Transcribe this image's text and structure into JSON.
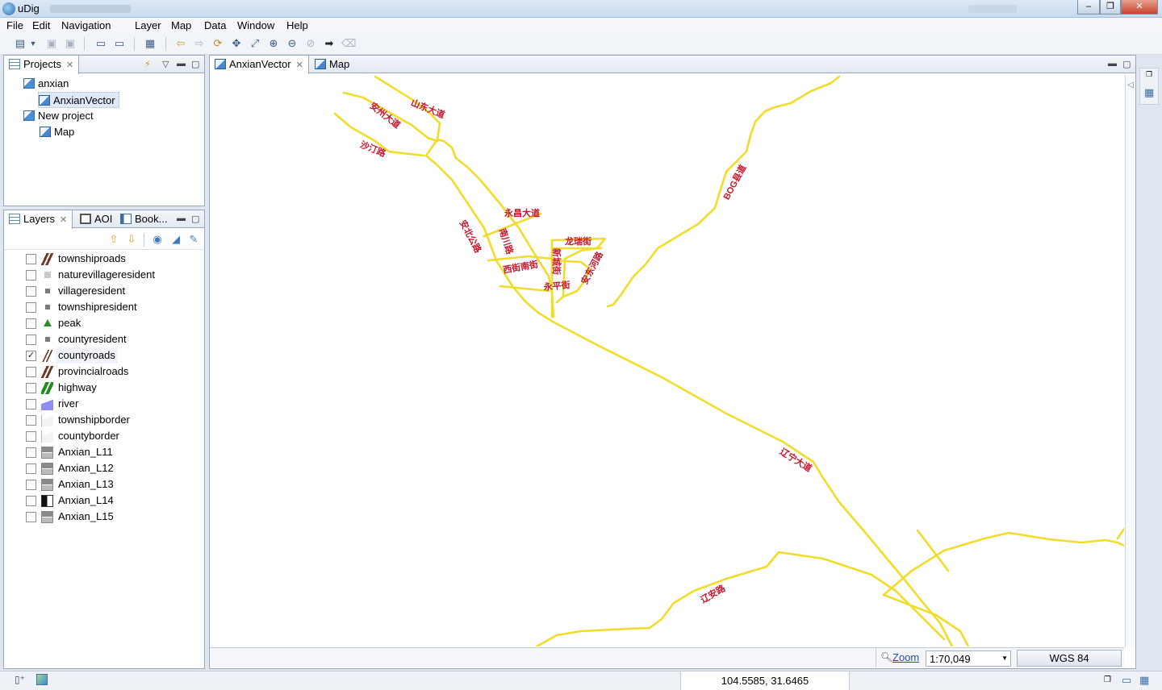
{
  "window": {
    "title": "uDig"
  },
  "menu": [
    "File",
    "Edit",
    "Navigation",
    "Layer",
    "Map",
    "Data",
    "Window",
    "Help"
  ],
  "projects_view": {
    "tab_label": "Projects",
    "tree": [
      {
        "label": "anxian",
        "level": 0,
        "kind": "project"
      },
      {
        "label": "AnxianVector",
        "level": 1,
        "kind": "map",
        "selected": true
      },
      {
        "label": "New project",
        "level": 0,
        "kind": "project"
      },
      {
        "label": "Map",
        "level": 1,
        "kind": "map"
      }
    ]
  },
  "layers_view": {
    "tabs": [
      "Layers",
      "AOI",
      "Book..."
    ],
    "layers": [
      {
        "name": "townshiproads",
        "checked": false,
        "icon": "line-brown"
      },
      {
        "name": "naturevillageresident",
        "checked": false,
        "icon": "square-lightgray"
      },
      {
        "name": "villageresident",
        "checked": false,
        "icon": "dot-gray"
      },
      {
        "name": "townshipresident",
        "checked": false,
        "icon": "dot-gray"
      },
      {
        "name": "peak",
        "checked": false,
        "icon": "triangle-green"
      },
      {
        "name": "countyresident",
        "checked": false,
        "icon": "dot-gray"
      },
      {
        "name": "countyroads",
        "checked": true,
        "icon": "line-brown-thin"
      },
      {
        "name": "provincialroads",
        "checked": false,
        "icon": "line-brown"
      },
      {
        "name": "highway",
        "checked": false,
        "icon": "line-green"
      },
      {
        "name": "river",
        "checked": false,
        "icon": "polygon-blue"
      },
      {
        "name": "townshipborder",
        "checked": false,
        "icon": "polygon-outline"
      },
      {
        "name": "countyborder",
        "checked": false,
        "icon": "polygon-outline"
      },
      {
        "name": "Anxian_L11",
        "checked": false,
        "icon": "raster-gray"
      },
      {
        "name": "Anxian_L12",
        "checked": false,
        "icon": "raster-gray"
      },
      {
        "name": "Anxian_L13",
        "checked": false,
        "icon": "raster-gray"
      },
      {
        "name": "Anxian_L14",
        "checked": false,
        "icon": "raster-black"
      },
      {
        "name": "Anxian_L15",
        "checked": false,
        "icon": "raster-gray"
      }
    ]
  },
  "editor_tabs": [
    {
      "label": "AnxianVector",
      "active": true
    },
    {
      "label": "Map",
      "active": false
    }
  ],
  "map": {
    "road_color": "#f2dc2a",
    "label_color": "#c8142a",
    "labels": [
      "山东大道",
      "安州大道",
      "沙汀路",
      "永昌大道",
      "安北公路",
      "南川路",
      "龙瑞街",
      "西街南街",
      "新城街",
      "安东河路",
      "永平街",
      "BOG县道",
      "辽宁大道",
      "辽安路"
    ]
  },
  "map_status": {
    "zoom_label": "Zoom",
    "scale": "1:70,049",
    "crs": "WGS 84"
  },
  "status_bar": {
    "coordinates": "104.5585, 31.6465"
  }
}
